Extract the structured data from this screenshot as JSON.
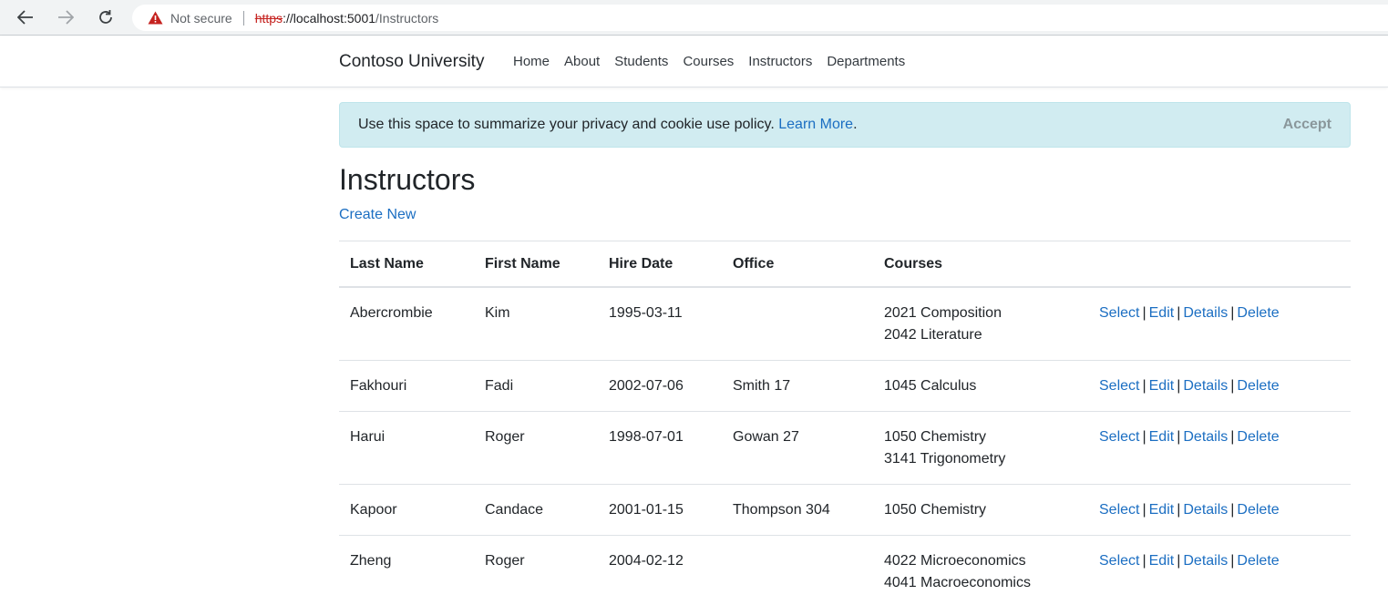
{
  "browser": {
    "security_label": "Not secure",
    "url_scheme": "https",
    "url_host": "://localhost:5001",
    "url_path": "/Instructors"
  },
  "navbar": {
    "brand": "Contoso University",
    "links": [
      "Home",
      "About",
      "Students",
      "Courses",
      "Instructors",
      "Departments"
    ]
  },
  "cookie": {
    "message": "Use this space to summarize your privacy and cookie use policy.",
    "link": "Learn More",
    "period": ".",
    "accept": "Accept"
  },
  "page": {
    "title": "Instructors",
    "create_new": "Create New"
  },
  "table": {
    "headers": [
      "Last Name",
      "First Name",
      "Hire Date",
      "Office",
      "Courses",
      ""
    ],
    "rows": [
      {
        "last": "Abercrombie",
        "first": "Kim",
        "hire": "1995-03-11",
        "office": "",
        "courses": [
          "2021 Composition",
          "2042 Literature"
        ]
      },
      {
        "last": "Fakhouri",
        "first": "Fadi",
        "hire": "2002-07-06",
        "office": "Smith 17",
        "courses": [
          "1045 Calculus"
        ]
      },
      {
        "last": "Harui",
        "first": "Roger",
        "hire": "1998-07-01",
        "office": "Gowan 27",
        "courses": [
          "1050 Chemistry",
          "3141 Trigonometry"
        ]
      },
      {
        "last": "Kapoor",
        "first": "Candace",
        "hire": "2001-01-15",
        "office": "Thompson 304",
        "courses": [
          "1050 Chemistry"
        ]
      },
      {
        "last": "Zheng",
        "first": "Roger",
        "hire": "2004-02-12",
        "office": "",
        "courses": [
          "4022 Microeconomics",
          "4041 Macroeconomics"
        ]
      }
    ],
    "actions": [
      "Select",
      "Edit",
      "Details",
      "Delete"
    ],
    "action_separator": "|"
  }
}
